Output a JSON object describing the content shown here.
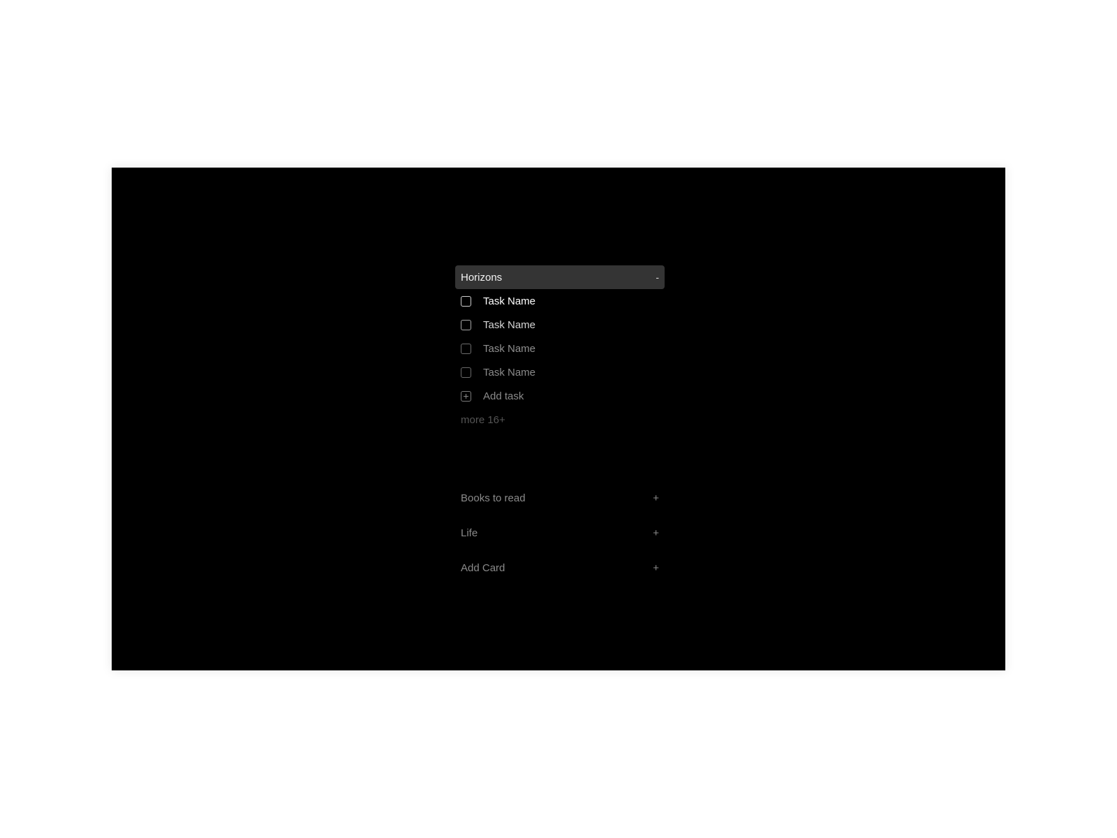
{
  "active_card": {
    "title": "Horizons",
    "collapse_icon": "-",
    "tasks": [
      {
        "label": "Task Name",
        "checked": false,
        "color": "#ffffff"
      },
      {
        "label": "Task Name",
        "checked": false,
        "color": "#d6d6d6"
      },
      {
        "label": "Task Name",
        "checked": false,
        "color": "#8f8f8f"
      },
      {
        "label": "Task Name",
        "checked": false,
        "color": "#8a8a8a"
      }
    ],
    "add_task_label": "Add task",
    "more_label": "more 16+"
  },
  "cards": [
    {
      "label": "Books to read",
      "icon": "+"
    },
    {
      "label": "Life",
      "icon": "+"
    },
    {
      "label": "Add Card",
      "icon": "+"
    }
  ]
}
